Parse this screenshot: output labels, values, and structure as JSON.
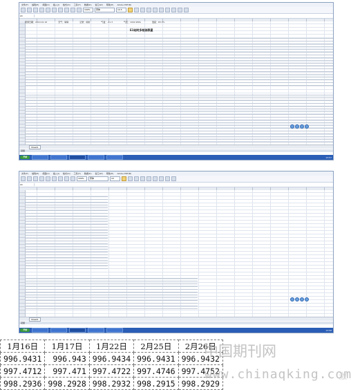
{
  "spreadsheet1": {
    "menu": [
      "文件(F)",
      "编辑(E)",
      "视图(V)",
      "插入(I)",
      "格式(O)",
      "工具(T)",
      "数据(D)",
      "窗口(W)",
      "帮助(H)",
      "Adobe PDF(B)"
    ],
    "font": "宋体",
    "font_size": "10.5",
    "zoom": "100%",
    "sheet_title": "E1站时多检测表星",
    "sheet_tab": "Sheet1",
    "status": "就绪",
    "taskbar_start": "开始",
    "clock": "13:57",
    "header_fields": [
      "观测日期：2010.01.16",
      "天气：晴晴",
      "记录：蒋新",
      "气温：-21.3",
      "气压：1002.9hPa",
      "湿度：65.3%"
    ]
  },
  "spreadsheet2": {
    "menu": [
      "文件(F)",
      "编辑(E)",
      "视图(V)",
      "插入(I)",
      "格式(O)",
      "工具(T)",
      "数据(D)",
      "窗口(W)",
      "帮助(H)",
      "Adobe PDF(B)"
    ],
    "font": "宋体",
    "font_size": "10",
    "zoom": "100%",
    "sheet_tab": "Sheet1",
    "status": "就绪",
    "taskbar_start": "开始",
    "clock": "13:58"
  },
  "comparison_table": {
    "headers": [
      "1月16日",
      "1月17日",
      "1月22日",
      "2月25日",
      "2月26日"
    ],
    "rows": [
      [
        "996.9431",
        "996.943",
        "996.9434",
        "996.9431",
        "996.9432"
      ],
      [
        "997.4712",
        "997.471",
        "997.4722",
        "997.4746",
        "997.4752"
      ],
      [
        "998.2936",
        "998.2928",
        "998.2932",
        "998.2915",
        "998.2929"
      ]
    ]
  },
  "watermark": {
    "cn": "中国期刊网",
    "url": "www.chinaqking.com",
    "corner": "激"
  }
}
